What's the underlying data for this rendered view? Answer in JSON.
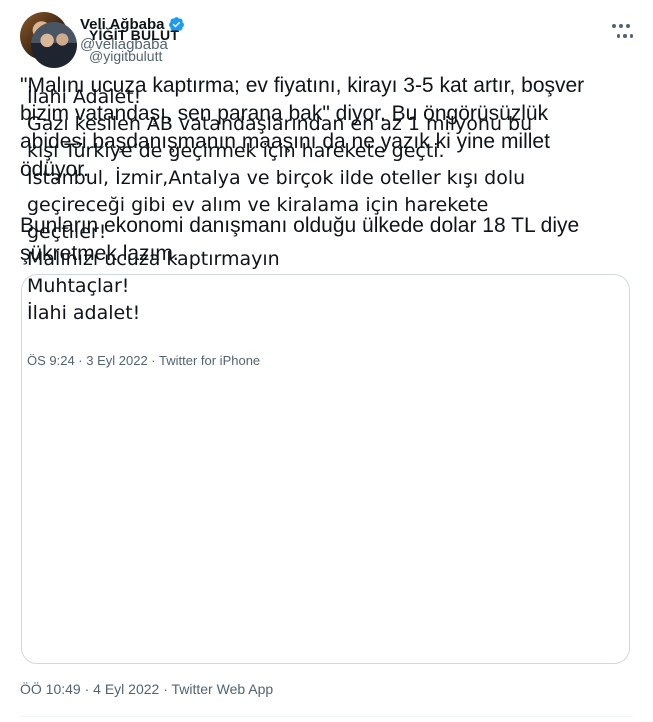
{
  "author": {
    "name": "Veli Ağbaba",
    "handle": "@veliagbaba",
    "avatar_icon": "profile-photo",
    "verified_icon": "verified-badge-icon",
    "verified_color": "#1d9bf0"
  },
  "tweet": {
    "text": "\"Malını ucuza kaptırma; ev fiyatını, kirayı 3-5 kat artır, boşver\nbizim vatandaşı, sen parana bak\" diyor. Bu öngörüsüzlük\nabidesi başdanışmanın maaşını da ne yazık ki yine millet\nödüyor.\n\nBunların ekonomi danışmanı olduğu ülkede dolar 18 TL diye\nşükretmek lazım.",
    "timestamp": "ÖÖ 10:49 · 4 Eyl 2022 · Twitter Web App"
  },
  "quoted_tweet": {
    "name": "YİĞİT BULUT",
    "handle": "@yigitbulutt",
    "text": "İlahi Adalet!\nGazı kesilen AB vatandaşlarından en az 1 milyonu bu\nkışı Türkiye’de geçirmek için harekete geçti.\nİstanbul, İzmir,Antalya ve birçok ilde oteller kışı dolu\ngeçireceği gibi ev alım ve kiralama için harekete\ngeçtiler!\nMalınızı ucuza kaptırmayın\nMuhtaçlar!\nİlahi adalet!",
    "timestamp": "ÖS 9:24 · 3 Eyl 2022 · Twitter for iPhone"
  },
  "colors": {
    "text": "#0f1419",
    "secondary": "#536471",
    "border": "#cfd9de"
  }
}
